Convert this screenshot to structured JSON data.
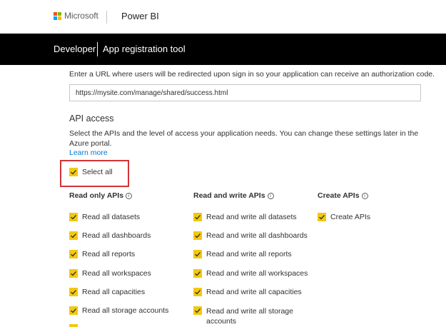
{
  "header": {
    "brand": "Microsoft",
    "product": "Power BI",
    "logo_colors": [
      "#f25022",
      "#7fba00",
      "#00a4ef",
      "#ffb900"
    ]
  },
  "nav": {
    "developer": "Developer",
    "tool": "App registration tool"
  },
  "redirect": {
    "instruction": "Enter a URL where users will be redirected upon sign in so your application can receive an authorization code.",
    "url_value": "https://mysite.com/manage/shared/success.html"
  },
  "api_access": {
    "title": "API access",
    "description": "Select the APIs and the level of access your application needs. You can change these settings later in the Azure portal.",
    "learn_more": "Learn more",
    "select_all": "Select all",
    "highlight_color": "#d13438",
    "checkbox_color": "#f2c811"
  },
  "columns": {
    "read_only": {
      "title": "Read only APIs",
      "items": [
        "Read all datasets",
        "Read all dashboards",
        "Read all reports",
        "Read all workspaces",
        "Read all capacities",
        "Read all storage accounts"
      ]
    },
    "read_write": {
      "title": "Read and write APIs",
      "items": [
        "Read and write all datasets",
        "Read and write all dashboards",
        "Read and write all reports",
        "Read and write all workspaces",
        "Read and write all capacities",
        "Read and write all storage accounts"
      ]
    },
    "create": {
      "title": "Create APIs",
      "items": [
        "Create APIs"
      ]
    }
  }
}
